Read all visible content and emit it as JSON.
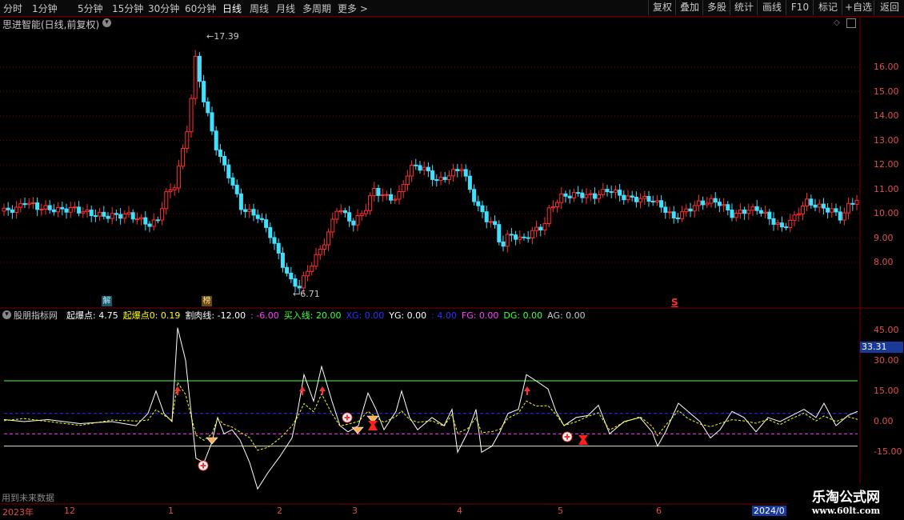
{
  "toolbar": {
    "periods": [
      "分时",
      "1分钟",
      "5分钟",
      "15分钟",
      "30分钟",
      "60分钟",
      "日线",
      "周线",
      "月线",
      "多周期",
      "更多 >"
    ],
    "active": "日线",
    "right_buttons": [
      "复权",
      "叠加",
      "多股",
      "统计",
      "画线",
      "F10",
      "标记",
      "+自选",
      "返回"
    ]
  },
  "main": {
    "title": "思进智能(日线,前复权)",
    "high_label": "17.39",
    "low_label": "6.71",
    "y_ticks": [
      "16.00",
      "15.00",
      "14.00",
      "13.00",
      "12.00",
      "11.00",
      "10.00",
      "9.00",
      "8.00"
    ],
    "marker_jie": "解",
    "marker_bang": "榜",
    "marker_s": "S"
  },
  "indicator": {
    "name": "股朋指标网",
    "fields": [
      {
        "label": "起爆点:",
        "value": "4.75",
        "color": "#ffffff"
      },
      {
        "label": "起爆点0:",
        "value": "0.19",
        "color": "#ffff00"
      },
      {
        "label": "割肉线:",
        "value": "-12.00",
        "color": "#ffffff"
      },
      {
        "label": ":",
        "value": "-6.00",
        "color": "#ff40ff"
      },
      {
        "label": "买入线:",
        "value": "20.00",
        "color": "#40ff40"
      },
      {
        "label": "XG:",
        "value": "0.00",
        "color": "#3030ff"
      },
      {
        "label": "YG:",
        "value": "0.00",
        "color": "#ffffff"
      },
      {
        "label": ":",
        "value": "4.00",
        "color": "#3030ff"
      },
      {
        "label": "FG:",
        "value": "0.00",
        "color": "#ff40ff"
      },
      {
        "label": "DG:",
        "value": "0.00",
        "color": "#40ff40"
      },
      {
        "label": "AG:",
        "value": "0.00",
        "color": "#c8c8c8"
      }
    ],
    "y_ticks": [
      "45.00",
      "30.00",
      "15.00",
      "0.00",
      "-15.00"
    ],
    "current_value": "33.31",
    "footer_note": "用到未来数据"
  },
  "xaxis": {
    "labels": [
      "2023年",
      "12",
      "1",
      "2",
      "3",
      "4",
      "5",
      "6",
      "2024/0"
    ]
  },
  "watermark": {
    "title": "乐淘公式网",
    "url": "www.60lt.com"
  },
  "colors": {
    "up": "#ff3030",
    "down": "#40e0ff",
    "grid": "#7a0000",
    "axis": "#e05050"
  }
}
